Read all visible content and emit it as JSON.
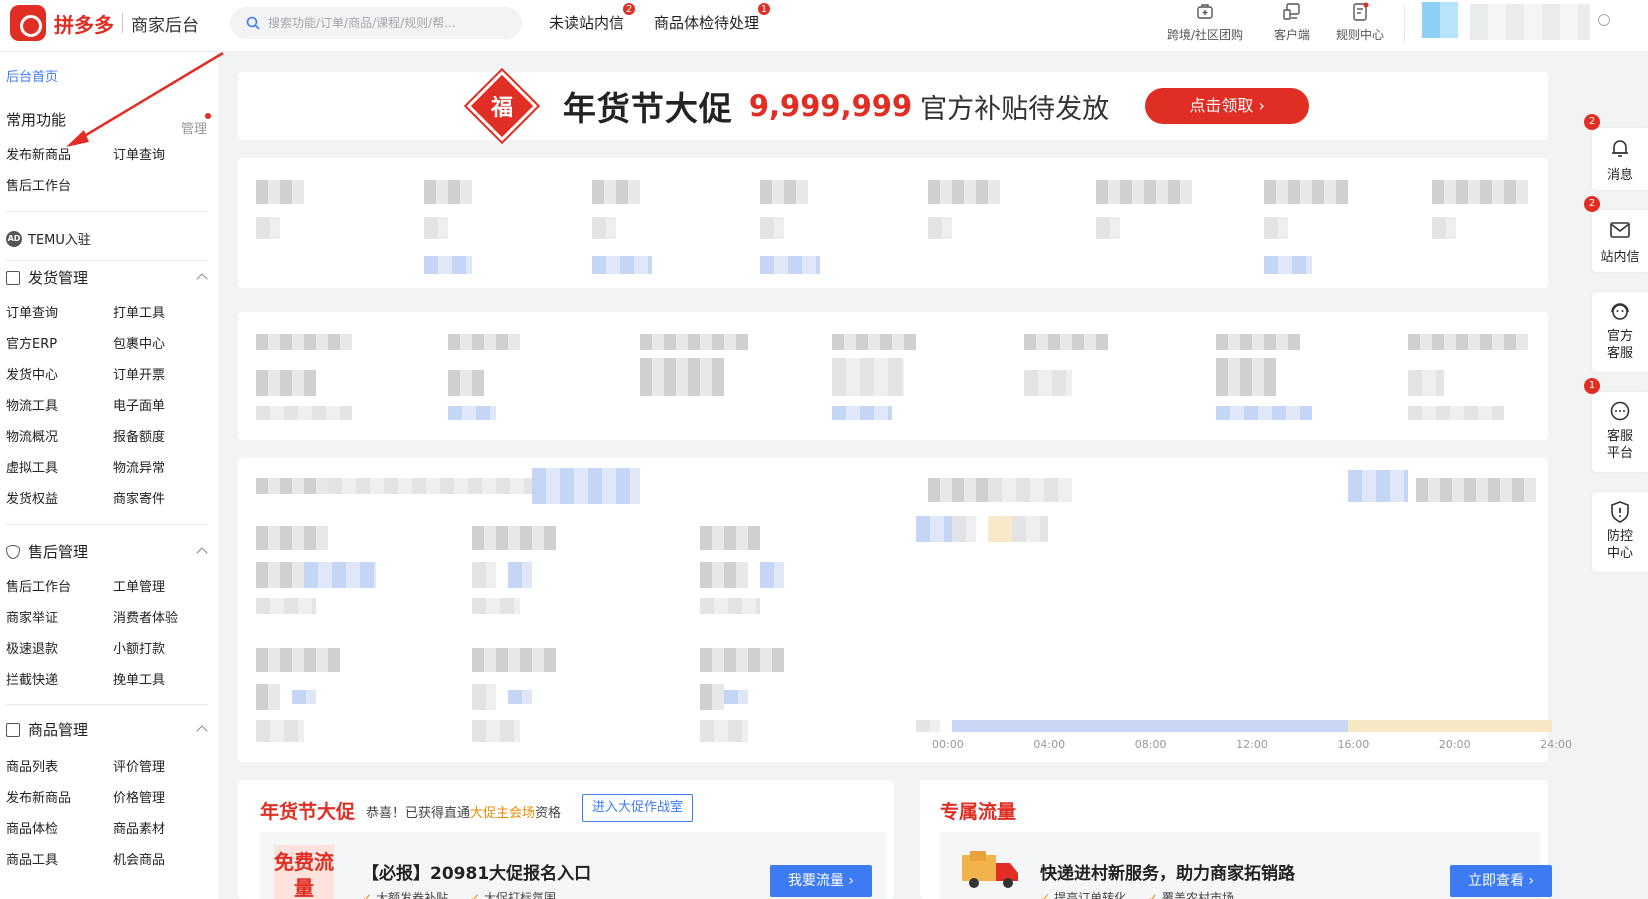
{
  "header": {
    "brand": "拼多多",
    "subtitle": "商家后台",
    "search_placeholder": "搜索功能/订单/商品/课程/规则/帮...",
    "nav": [
      {
        "label": "未读站内信",
        "badge": "2"
      },
      {
        "label": "商品体检待处理",
        "badge": "1"
      }
    ],
    "tools": [
      {
        "label": "跨境/社区团购",
        "icon": "community-icon"
      },
      {
        "label": "客户端",
        "icon": "desktop-client-icon"
      },
      {
        "label": "规则中心",
        "icon": "rules-doc-icon"
      }
    ]
  },
  "sidebar": {
    "home": "后台首页",
    "common": {
      "title": "常用功能",
      "manage": "管理",
      "items": [
        "发布新商品",
        "订单查询",
        "售后工作台"
      ]
    },
    "temu": {
      "badge": "AD",
      "label": "TEMU入驻"
    },
    "sections": [
      {
        "title": "发货管理",
        "items": [
          "订单查询",
          "打单工具",
          "官方ERP",
          "包裹中心",
          "发货中心",
          "订单开票",
          "物流工具",
          "电子面单",
          "物流概况",
          "报备额度",
          "虚拟工具",
          "物流异常",
          "发货权益",
          "商家寄件"
        ]
      },
      {
        "title": "售后管理",
        "items": [
          "售后工作台",
          "工单管理",
          "商家举证",
          "消费者体验",
          "极速退款",
          "小额打款",
          "拦截快递",
          "挽单工具"
        ]
      },
      {
        "title": "商品管理",
        "items": [
          "商品列表",
          "评价管理",
          "发布新商品",
          "价格管理",
          "商品体检",
          "商品素材",
          "商品工具",
          "机会商品"
        ]
      }
    ]
  },
  "banner": {
    "badge": "福",
    "title": "年货节大促",
    "amount": "9,999,999",
    "subtitle": "官方补贴待发放",
    "button": "点击领取"
  },
  "right_rail": [
    {
      "label": "消息",
      "badge": "2",
      "icon": "bell-icon"
    },
    {
      "label": "站内信",
      "badge": "2",
      "icon": "mail-icon"
    },
    {
      "label": "官方客服",
      "badge": "",
      "icon": "headset-icon"
    },
    {
      "label": "客服平台",
      "badge": "1",
      "icon": "chat-bubble-icon"
    },
    {
      "label": "防控中心",
      "badge": "",
      "icon": "shield-icon"
    }
  ],
  "promo_card": {
    "title": "年货节大促",
    "note_prefix": "恭喜！已获得直通",
    "note_highlight": "大促主会场",
    "note_suffix": "资格",
    "enter_button": "进入大促作战室",
    "tag": "免费流量",
    "item_title": "【必报】20981大促报名入口",
    "item_button": "我要流量",
    "checks": [
      "大额发券补贴",
      "大促打标氛围"
    ]
  },
  "traffic_card": {
    "title": "专属流量",
    "item_title": "快递进村新服务，助力商家拓销路",
    "item_button": "立即查看",
    "checks": [
      "提高订单转化",
      "覆盖农村市场"
    ]
  },
  "chart_axis_ticks": [
    "00:00",
    "04:00",
    "08:00",
    "12:00",
    "16:00",
    "20:00",
    "24:00"
  ]
}
